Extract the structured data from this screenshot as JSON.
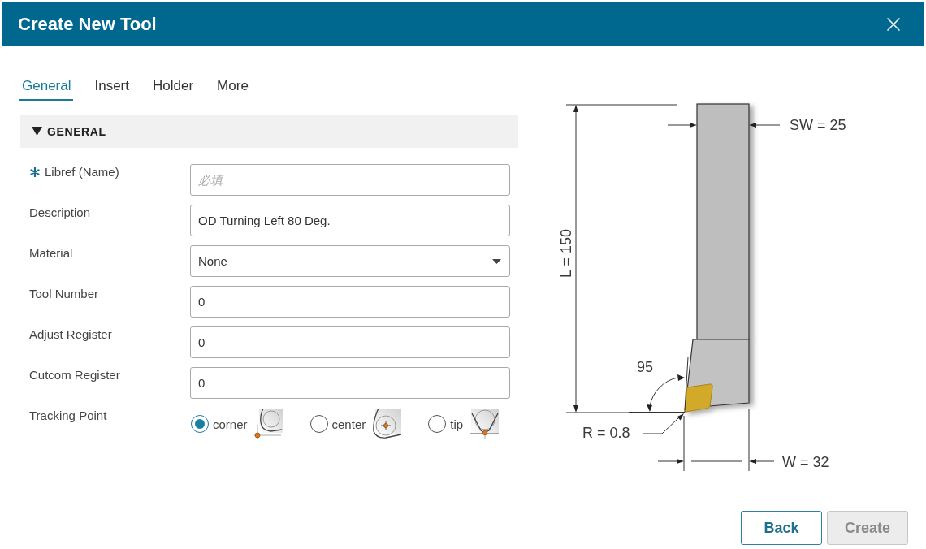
{
  "window": {
    "title": "Create New Tool"
  },
  "tabs": [
    {
      "label": "General",
      "selected": true
    },
    {
      "label": "Insert",
      "selected": false
    },
    {
      "label": "Holder",
      "selected": false
    },
    {
      "label": "More",
      "selected": false
    }
  ],
  "section": {
    "title": "GENERAL",
    "expanded": true
  },
  "fields": [
    {
      "kind": "text",
      "label": "Libref (Name)",
      "required": true,
      "placeholder": "必填"
    },
    {
      "kind": "text",
      "label": "Description",
      "required": false,
      "value": "OD Turning Left 80 Deg."
    },
    {
      "kind": "select",
      "label": "Material",
      "required": false,
      "value": "None"
    },
    {
      "kind": "text",
      "label": "Tool Number",
      "required": false,
      "value": "0"
    },
    {
      "kind": "text",
      "label": "Adjust Register",
      "required": false,
      "value": "0"
    },
    {
      "kind": "text",
      "label": "Cutcom Register",
      "required": false,
      "value": "0"
    },
    {
      "kind": "radio",
      "label": "Tracking Point",
      "required": false,
      "options": [
        {
          "label": "corner",
          "selected": true
        },
        {
          "label": "center",
          "selected": false
        },
        {
          "label": "tip",
          "selected": false
        }
      ]
    }
  ],
  "tool_drawing": {
    "dimension_labels": [
      "SW = 25",
      "L = 150",
      "95",
      "R = 0.8",
      "W = 32"
    ]
  },
  "buttons": [
    {
      "label": "Back",
      "disabled": false
    },
    {
      "label": "Create",
      "disabled": true
    }
  ]
}
